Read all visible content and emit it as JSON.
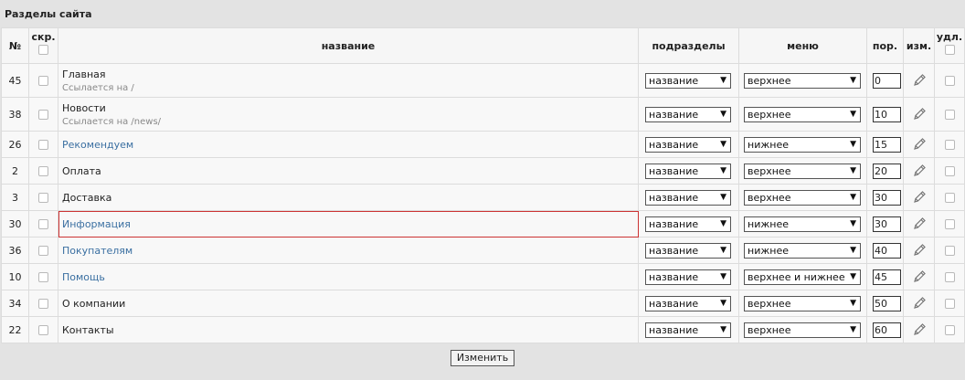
{
  "page_title": "Разделы сайта",
  "headers": {
    "num": "№",
    "hidden": "скр.",
    "name": "название",
    "subsections": "подразделы",
    "menu": "меню",
    "order": "пор.",
    "edit": "изм.",
    "delete": "удл."
  },
  "rows": [
    {
      "id": "45",
      "name": "Главная",
      "sub": "Ссылается на /",
      "link": false,
      "subsections": "название",
      "menu": "верхнее",
      "order": "0"
    },
    {
      "id": "38",
      "name": "Новости",
      "sub": "Ссылается на /news/",
      "link": false,
      "subsections": "название",
      "menu": "верхнее",
      "order": "10"
    },
    {
      "id": "26",
      "name": "Рекомендуем",
      "sub": "",
      "link": true,
      "subsections": "название",
      "menu": "нижнее",
      "order": "15"
    },
    {
      "id": "2",
      "name": "Оплата",
      "sub": "",
      "link": false,
      "subsections": "название",
      "menu": "верхнее",
      "order": "20"
    },
    {
      "id": "3",
      "name": "Доставка",
      "sub": "",
      "link": false,
      "subsections": "название",
      "menu": "верхнее",
      "order": "30"
    },
    {
      "id": "30",
      "name": "Информация",
      "sub": "",
      "link": true,
      "highlight": true,
      "subsections": "название",
      "menu": "нижнее",
      "order": "30"
    },
    {
      "id": "36",
      "name": "Покупателям",
      "sub": "",
      "link": true,
      "subsections": "название",
      "menu": "нижнее",
      "order": "40"
    },
    {
      "id": "10",
      "name": "Помощь",
      "sub": "",
      "link": true,
      "subsections": "название",
      "menu": "верхнее и нижнее",
      "order": "45"
    },
    {
      "id": "34",
      "name": "О компании",
      "sub": "",
      "link": false,
      "subsections": "название",
      "menu": "верхнее",
      "order": "50"
    },
    {
      "id": "22",
      "name": "Контакты",
      "sub": "",
      "link": false,
      "subsections": "название",
      "menu": "верхнее",
      "order": "60"
    }
  ],
  "submit_label": "Изменить",
  "colors": {
    "link": "#3a6fa1",
    "highlight_border": "#cc3333"
  }
}
